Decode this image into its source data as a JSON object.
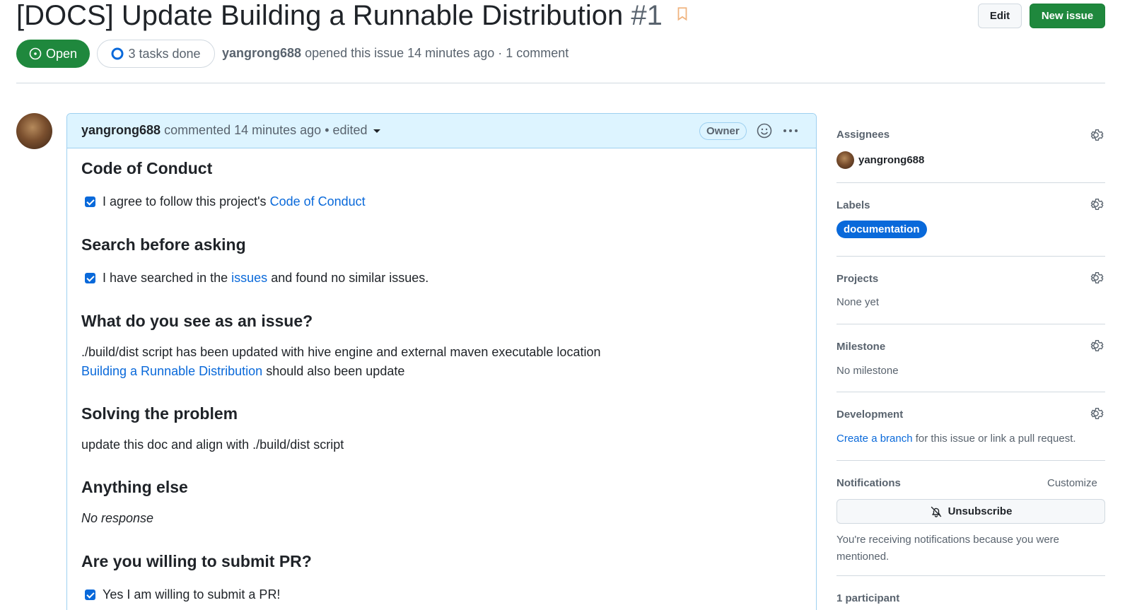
{
  "header": {
    "title": "[DOCS] Update Building a Runnable Distribution",
    "number": "#1",
    "edit_label": "Edit",
    "new_issue_label": "New issue",
    "state_label": "Open",
    "tasks_label": "3 tasks done",
    "author": "yangrong688",
    "opened_text": "opened this issue 14 minutes ago · 1 comment"
  },
  "comment": {
    "author": "yangrong688",
    "meta_text": "commented 14 minutes ago",
    "edited_text": "• edited",
    "owner_badge": "Owner",
    "sections": {
      "coc_heading": "Code of Conduct",
      "coc_text": "I agree to follow this project's",
      "coc_link": "Code of Conduct",
      "search_heading": "Search before asking",
      "search_text_pre": "I have searched in the",
      "search_link": "issues",
      "search_text_post": "and found no similar issues.",
      "issue_heading": "What do you see as an issue?",
      "issue_line1": "./build/dist script has been updated with hive engine and external maven executable location",
      "issue_link": "Building a Runnable Distribution",
      "issue_line2_post": "should also been update",
      "solve_heading": "Solving the problem",
      "solve_text": "update this doc and align with ./build/dist script",
      "else_heading": "Anything else",
      "else_text": "No response",
      "pr_heading": "Are you willing to submit PR?",
      "pr_text": "Yes I am willing to submit a PR!"
    }
  },
  "sidebar": {
    "assignees_label": "Assignees",
    "assignee": "yangrong688",
    "labels_label": "Labels",
    "label_name": "documentation",
    "projects_label": "Projects",
    "projects_value": "None yet",
    "milestone_label": "Milestone",
    "milestone_value": "No milestone",
    "development_label": "Development",
    "dev_link": "Create a branch",
    "dev_text": "for this issue or link a pull request.",
    "notifications_label": "Notifications",
    "customize_label": "Customize",
    "unsubscribe_label": "Unsubscribe",
    "notif_text": "You're receiving notifications because you were mentioned.",
    "participants": "1 participant"
  },
  "colors": {
    "open_green": "#1f883d",
    "link_blue": "#0969da",
    "comment_header": "#ddf4ff"
  }
}
